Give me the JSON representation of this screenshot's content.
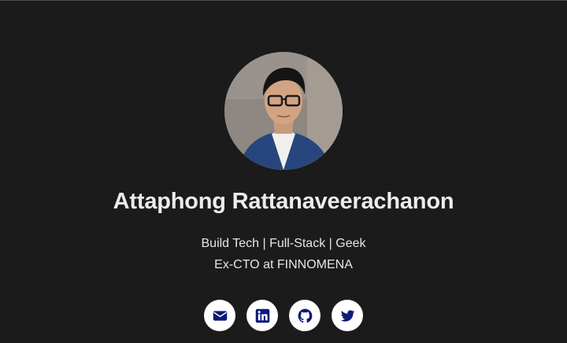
{
  "profile": {
    "name": "Attaphong Rattanaveerachanon",
    "tagline": "Build Tech | Full-Stack | Geek",
    "role": "Ex-CTO at FINNOMENA"
  },
  "socials": [
    {
      "icon": "envelope-icon"
    },
    {
      "icon": "linkedin-icon"
    },
    {
      "icon": "github-icon"
    },
    {
      "icon": "twitter-icon"
    }
  ],
  "colors": {
    "background": "#1c1b1b",
    "icon_color": "#0d1a7a",
    "icon_circle": "#ffffff"
  }
}
